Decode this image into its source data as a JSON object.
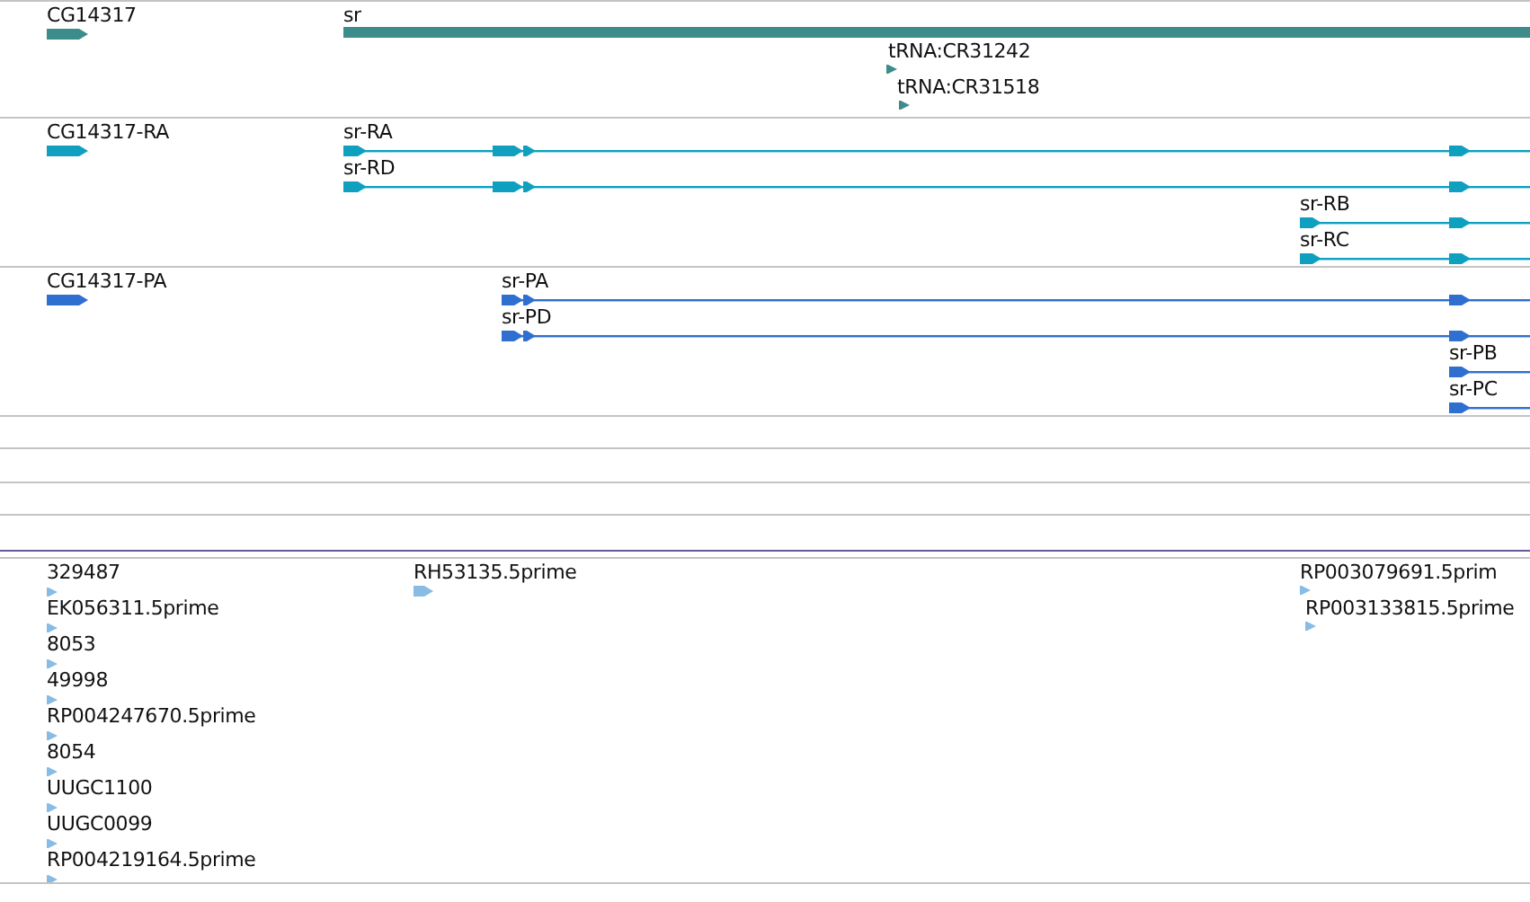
{
  "tracks": [
    {
      "kind": "features",
      "color": "#3d8c8c",
      "features": [
        {
          "label": "CG14317",
          "kind": "gene"
        },
        {
          "label": "sr",
          "kind": "bar"
        },
        {
          "label": "tRNA:CR31242",
          "kind": "mark"
        },
        {
          "label": "tRNA:CR31518",
          "kind": "mark"
        }
      ]
    },
    {
      "kind": "features",
      "color": "#0fa0c0",
      "features": [
        {
          "label": "CG14317-RA",
          "kind": "gene"
        },
        {
          "label": "sr-RA",
          "kind": "transcript"
        },
        {
          "label": "sr-RD",
          "kind": "transcript"
        },
        {
          "label": "sr-RB",
          "kind": "transcript"
        },
        {
          "label": "sr-RC",
          "kind": "transcript"
        }
      ]
    },
    {
      "kind": "features",
      "color": "#2f6fd0",
      "features": [
        {
          "label": "CG14317-PA",
          "kind": "gene"
        },
        {
          "label": "sr-PA",
          "kind": "transcript"
        },
        {
          "label": "sr-PD",
          "kind": "transcript"
        },
        {
          "label": "sr-PB",
          "kind": "transcript"
        },
        {
          "label": "sr-PC",
          "kind": "transcript"
        }
      ]
    },
    {
      "kind": "empty"
    },
    {
      "kind": "empty"
    },
    {
      "kind": "empty"
    },
    {
      "kind": "empty"
    },
    {
      "kind": "features",
      "color": "#88bce4",
      "features": [
        {
          "label": "329487",
          "kind": "mark"
        },
        {
          "label": "EK056311.5prime",
          "kind": "mark"
        },
        {
          "label": "8053",
          "kind": "mark"
        },
        {
          "label": "49998",
          "kind": "mark"
        },
        {
          "label": "RP004247670.5prime",
          "kind": "mark"
        },
        {
          "label": "8054",
          "kind": "mark"
        },
        {
          "label": "UUGC1100",
          "kind": "mark"
        },
        {
          "label": "UUGC0099",
          "kind": "mark"
        },
        {
          "label": "RP004219164.5prime",
          "kind": "mark"
        },
        {
          "label": "RH53135.5prime",
          "kind": "gene"
        },
        {
          "label": "RP003079691.5prim",
          "kind": "mark"
        },
        {
          "label": "RP003133815.5prime",
          "kind": "mark"
        }
      ]
    }
  ]
}
